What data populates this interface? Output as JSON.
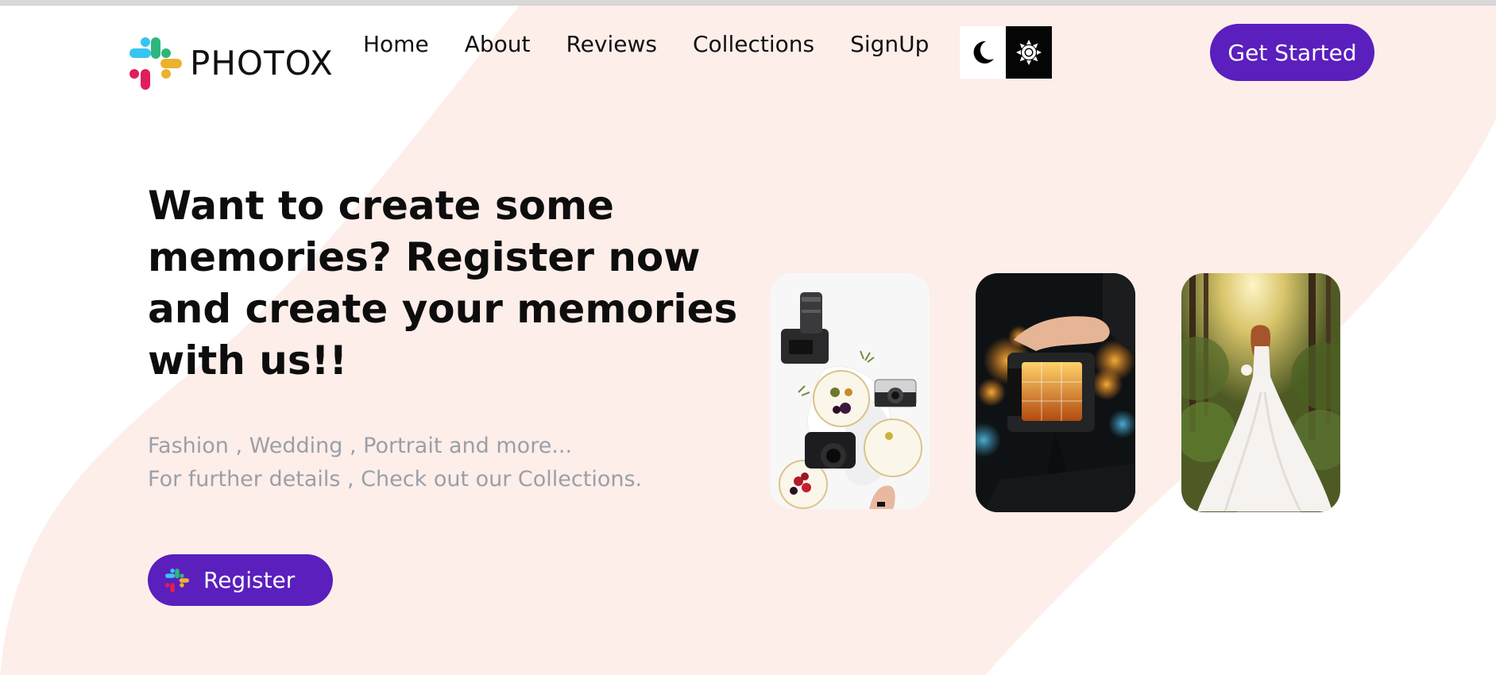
{
  "brand": {
    "name": "PHOTOX",
    "logo_icon": "slack-style-pinwheel-logo",
    "colors": [
      "#36c5f0",
      "#2eb67d",
      "#ecb22e",
      "#e01e5a"
    ]
  },
  "nav": {
    "links": [
      "Home",
      "About",
      "Reviews",
      "Collections",
      "SignUp"
    ]
  },
  "theme_toggle": {
    "dark_icon": "moon-icon",
    "light_icon": "sun-icon"
  },
  "cta": {
    "label": "Get Started"
  },
  "hero": {
    "title": "Want to create some memories? Register now and create your memories with us!!",
    "subtitle_lines": [
      "Fashion , Wedding , Portrait and more...",
      "For further details , Check out our Collections."
    ],
    "register_label": "Register",
    "register_icon": "slack-style-pinwheel-logo"
  },
  "gallery": {
    "images": [
      "cameras-and-food-flatlay",
      "camera-viewfinder-night",
      "bride-in-forest"
    ]
  },
  "theme": {
    "accent": "#5a1fbd",
    "background_band": "#fdeeea",
    "text": "#0d0d0d",
    "muted_text": "#9b9fa8"
  }
}
